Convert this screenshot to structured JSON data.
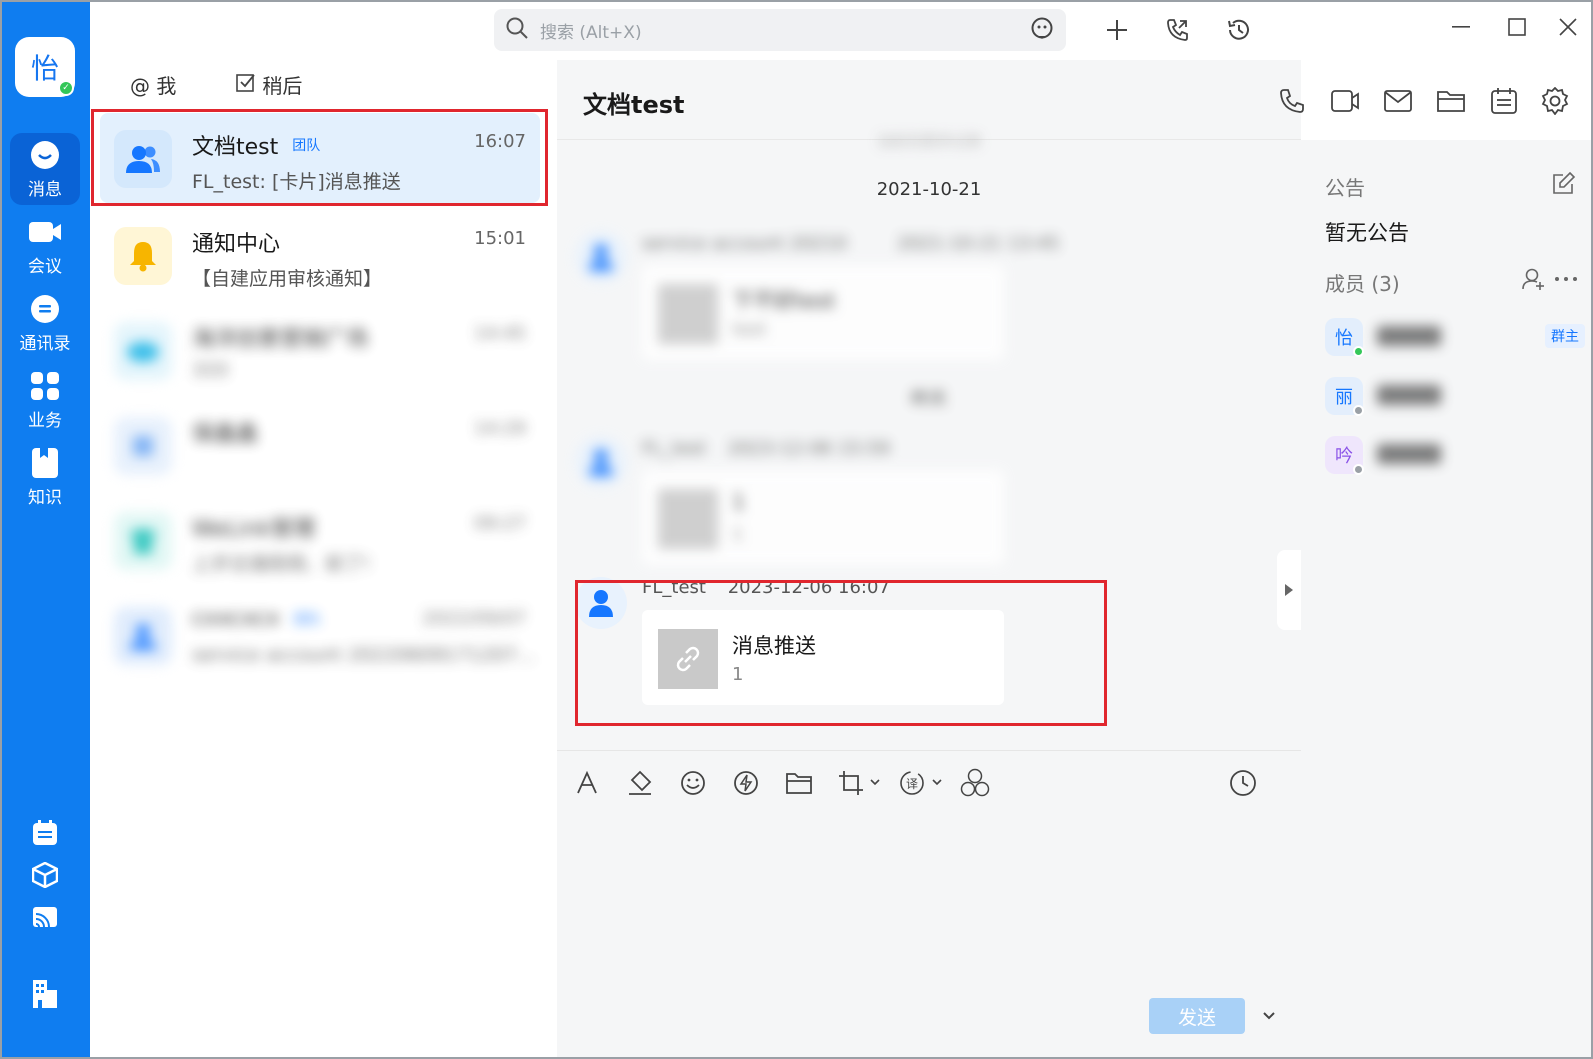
{
  "nav": {
    "avatar_char": "怡",
    "items": [
      {
        "label": "消息",
        "icon": "chat-bubble-icon"
      },
      {
        "label": "会议",
        "icon": "video-camera-icon"
      },
      {
        "label": "通讯录",
        "icon": "contacts-icon"
      },
      {
        "label": "业务",
        "icon": "apps-grid-icon"
      },
      {
        "label": "知识",
        "icon": "book-icon"
      }
    ],
    "bottom_icons": [
      "calendar-icon",
      "cube-icon",
      "cast-icon",
      "building-icon"
    ]
  },
  "search": {
    "placeholder": "搜索 (Alt+X)"
  },
  "list_tabs": {
    "mention": "@ 我",
    "later": "稍后"
  },
  "conversations": [
    {
      "name": "文档test",
      "badge": "团队",
      "time": "16:07",
      "preview": "FL_test: [卡片]消息推送",
      "selected": true
    },
    {
      "name": "通知中心",
      "time": "15:01",
      "preview": "【自建应用审核通知】"
    },
    {
      "name": "海洋创意营销广场",
      "time": "14:45",
      "preview": "333"
    },
    {
      "name": "保鑫鑫",
      "time": "14:29",
      "preview": ""
    },
    {
      "name": "WeLink管理",
      "time": "09:27",
      "preview": "上岁达逸陪观、前了!"
    },
    {
      "name": "cxxcxcx",
      "badge": "团队",
      "time": "2022/09/07",
      "preview": "service account 20220609171207..."
    }
  ],
  "chat": {
    "title": "文档test",
    "top_hint": "当前无更多记录",
    "date_sep": "2021-10-21",
    "messages": [
      {
        "sender": "service account 20210     ",
        "time": "2021-10-21 13:45",
        "card_title": "下不好test",
        "card_sub": "test"
      },
      {
        "sender": "FL_test",
        "time": "2023-12-06 15:59",
        "card_title": "1",
        "card_sub": "1"
      },
      {
        "sender": "FL_test",
        "time": "2023-12-06 16:07",
        "card_title": "消息推送",
        "card_sub": "1"
      }
    ],
    "mid_sep": "昨天",
    "send_label": "发送"
  },
  "side": {
    "notice_label": "公告",
    "notice_text": "暂无公告",
    "members_label": "成员 (3)",
    "members": [
      {
        "char": "怡",
        "role": "群主",
        "status_color": "#34c759"
      },
      {
        "char": "丽",
        "role": "",
        "status_color": "#9aa0a6"
      },
      {
        "char": "吟",
        "role": "",
        "status_color": "#9aa0a6"
      }
    ]
  },
  "colors": {
    "brand": "#0f7df0",
    "highlight": "#e0262e",
    "accent": "#1677ff"
  }
}
